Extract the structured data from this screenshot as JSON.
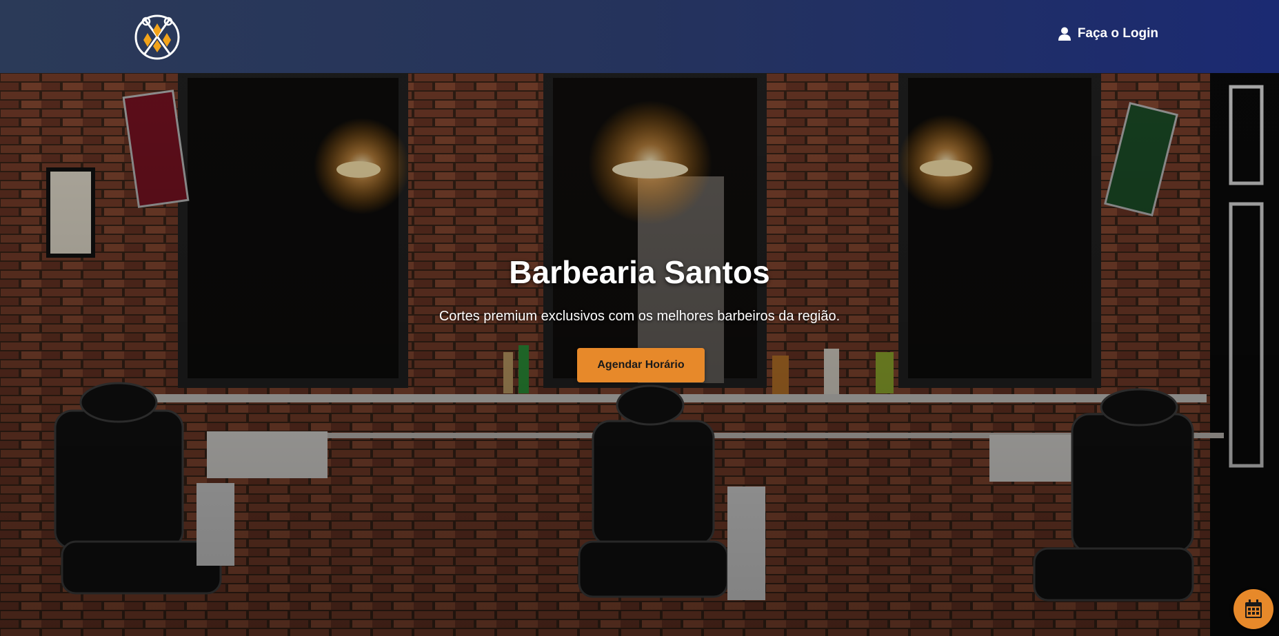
{
  "navbar": {
    "logo_icon": "scissors-diamond-logo-icon",
    "login_label": "Faça o Login",
    "login_icon": "user-icon"
  },
  "hero": {
    "title": "Barbearia Santos",
    "subtitle": "Cortes premium exclusivos com os melhores barbeiros da região.",
    "cta_label": "Agendar Horário",
    "background": "barbershop-interior-photo"
  },
  "fab": {
    "icon": "calendar-icon"
  },
  "colors": {
    "navbar_start": "#2b3a58",
    "navbar_end": "#1b2a72",
    "accent": "#e7892a",
    "text": "#ffffff"
  }
}
